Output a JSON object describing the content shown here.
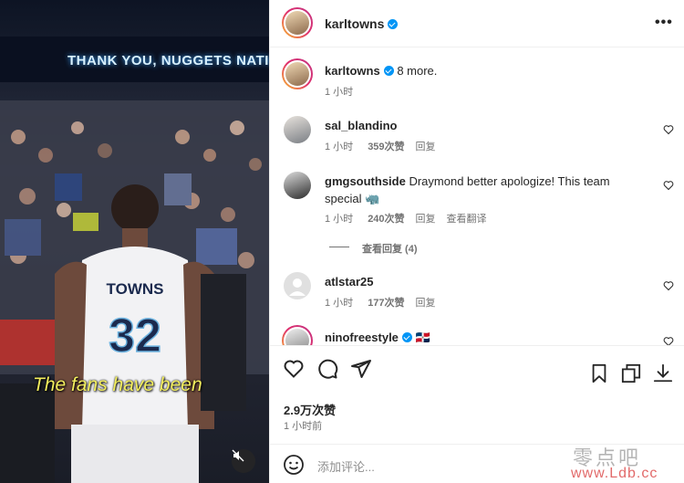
{
  "media": {
    "banner_text": "THANK YOU, NUGGETS NATION",
    "jersey_name": "TOWNS",
    "jersey_number": "32",
    "caption": "The fans have been"
  },
  "header": {
    "username": "karltowns",
    "more_label": "•••"
  },
  "post_caption": {
    "username": "karltowns",
    "text": "8 more.",
    "time": "1 小时"
  },
  "comments": [
    {
      "username": "sal_blandino",
      "text": "",
      "time": "1 小时",
      "likes": "359次赞",
      "reply": "回复",
      "translate": ""
    },
    {
      "username": "gmgsouthside",
      "text": "Draymond better apologize! This team",
      "text2": "special 🦏",
      "time": "1 小时",
      "likes": "240次赞",
      "reply": "回复",
      "translate": "查看翻译"
    },
    {
      "username": "atlstar25",
      "text": "",
      "time": "1 小时",
      "likes": "177次赞",
      "reply": "回复",
      "translate": ""
    },
    {
      "username": "ninofreestyle",
      "text": "🇩🇴",
      "time": "",
      "likes": "",
      "reply": "",
      "translate": ""
    }
  ],
  "view_replies": "查看回复 (4)",
  "likes_count": "2.9万次赞",
  "post_time": "1 小时前",
  "add_comment_placeholder": "添加评论...",
  "watermark": {
    "line1": "零点吧",
    "line2": "www.Ldb.cc"
  }
}
